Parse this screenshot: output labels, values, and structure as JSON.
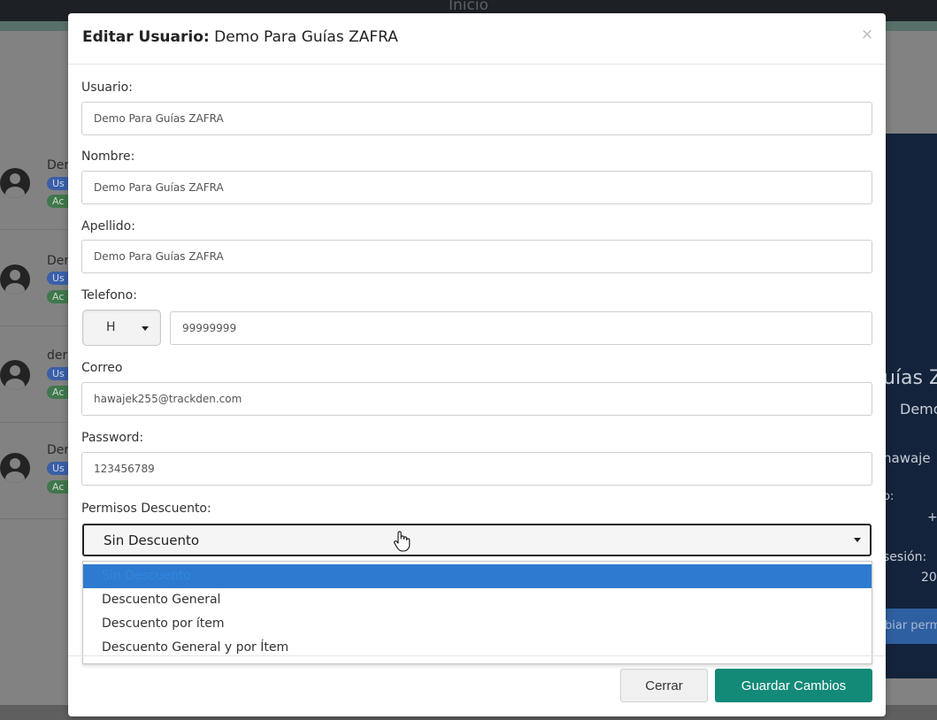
{
  "background": {
    "topbar_title": "Inicio",
    "list_items": [
      {
        "name": "Der",
        "role_badge": "Us",
        "status_badge": "Ac"
      },
      {
        "name": "Der",
        "role_badge": "Us",
        "status_badge": "Ac"
      },
      {
        "name": "der",
        "role_badge": "Us",
        "status_badge": "Ac"
      },
      {
        "name": "Der",
        "role_badge": "Us",
        "status_badge": "Ac"
      }
    ],
    "panel": {
      "name_fragment": "uías Z",
      "subtitle_fragment": "Demo",
      "email_fragment": "hawaje",
      "phone_label_fragment": "o:",
      "phone_value_fragment": "+",
      "session_label_fragment": "sesión:",
      "session_value_fragment": "20",
      "button_fragment": "biar perm"
    }
  },
  "modal": {
    "title_prefix": "Editar Usuario:",
    "title_name": "Demo Para Guías ZAFRA",
    "close_symbol": "×",
    "fields": {
      "usuario": {
        "label": "Usuario:",
        "value": "Demo Para Guías ZAFRA"
      },
      "nombre": {
        "label": "Nombre:",
        "value": "Demo Para Guías ZAFRA"
      },
      "apellido": {
        "label": "Apellido:",
        "value": "Demo Para Guías ZAFRA"
      },
      "telefono": {
        "label": "Telefono:",
        "prefix": "H",
        "value": "99999999"
      },
      "correo": {
        "label": "Correo",
        "value": "hawajek255@trackden.com"
      },
      "password": {
        "label": "Password:",
        "value": "123456789"
      }
    },
    "permisos": {
      "label": "Permisos Descuento:",
      "selected": "Sin Descuento",
      "options": [
        "Sin Descuento",
        "Descuento General",
        "Descuento por ítem",
        "Descuento General y por Ítem"
      ]
    },
    "buttons": {
      "close": "Cerrar",
      "save": "Guardar Cambios"
    }
  },
  "colors": {
    "primary_save": "#138a78",
    "option_highlight": "#2e7ad0"
  }
}
